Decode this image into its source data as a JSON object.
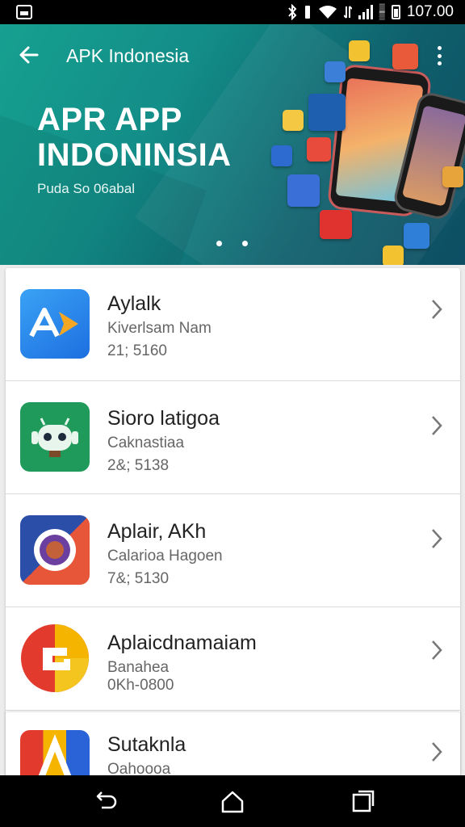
{
  "status_bar": {
    "time": "107.00"
  },
  "header": {
    "title": "APK Indonesia",
    "hero_heading_line1": "APR APP",
    "hero_heading_line2": "INDONINSIA",
    "hero_subtitle": "Puda So 06abal"
  },
  "apps": [
    {
      "name": "Aylalk",
      "developer": "Kiverlsam Nam",
      "meta": "21; 5160"
    },
    {
      "name": "Sioro latigoa",
      "developer": "Caknastiaa",
      "meta": "2&; 5138"
    },
    {
      "name": "Aplair, AKh",
      "developer": "Calarioa Hagoen",
      "meta": "7&; 5130"
    },
    {
      "name": "Aplaicdnamaiam",
      "developer": "Banahea",
      "meta": "0Kh-0800"
    },
    {
      "name": "Sutaknla",
      "developer": "Oahoooa",
      "meta": ""
    }
  ],
  "colors": {
    "hero_start": "#16a090",
    "hero_end": "#0d4e63",
    "status_bar": "#000000"
  }
}
